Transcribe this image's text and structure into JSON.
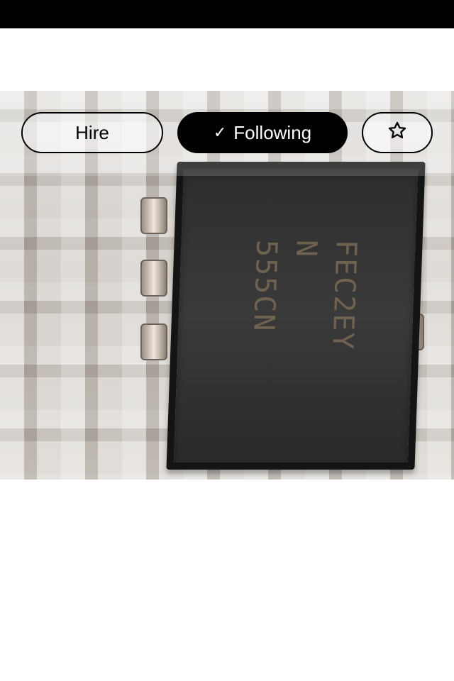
{
  "actions": {
    "hire_label": "Hire",
    "following_label": "Following",
    "following_check": "✓",
    "favorite_icon": "star-outline-icon"
  },
  "photo": {
    "chip_text_lines": [
      "FEC2EY",
      "N",
      "555CN"
    ]
  },
  "colors": {
    "status_bar": "#000000",
    "following_bg": "#000000",
    "following_text": "#ffffff",
    "outline": "#000000"
  }
}
